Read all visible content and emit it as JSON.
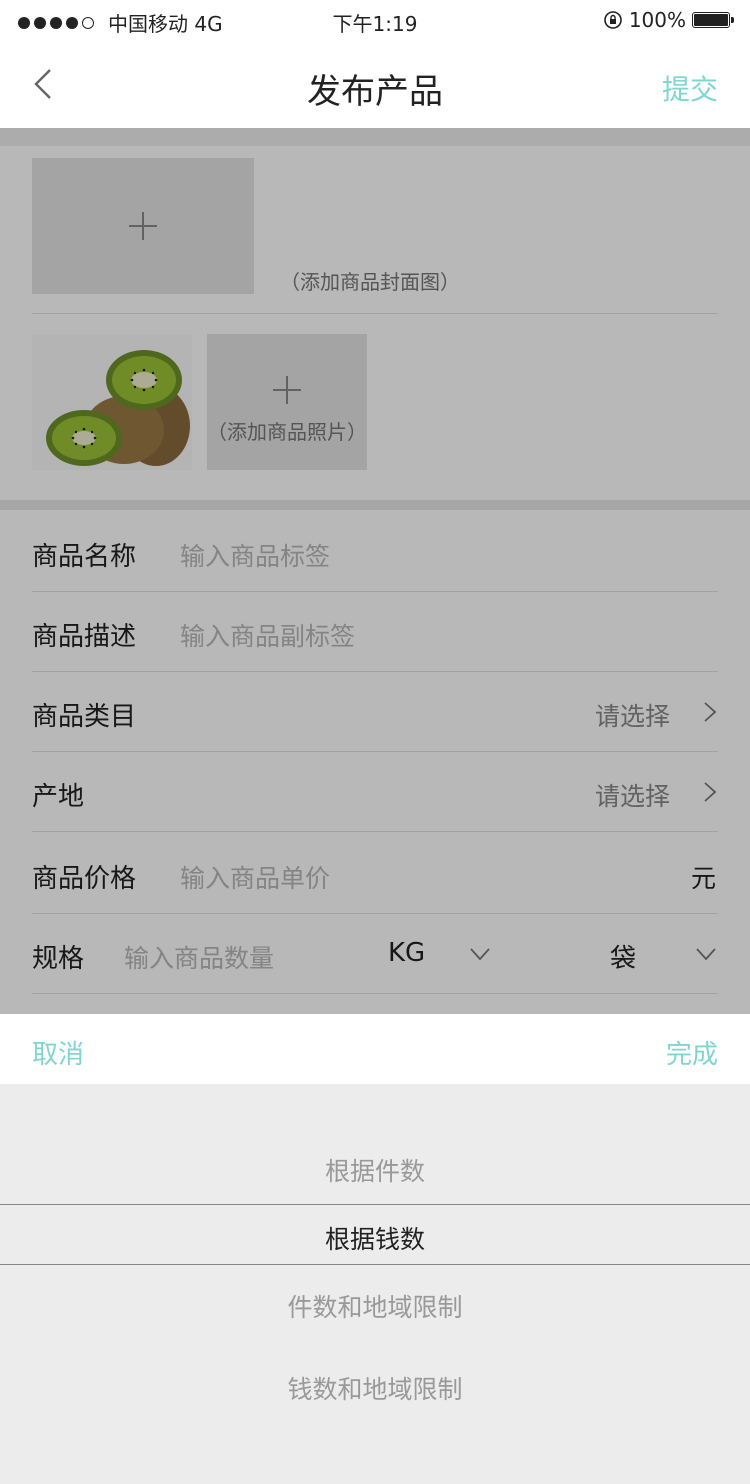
{
  "status_bar": {
    "carrier": "中国移动 4G",
    "time": "下午1:19",
    "battery": "100%"
  },
  "nav": {
    "title": "发布产品",
    "submit": "提交"
  },
  "images": {
    "cover_label": "（添加商品封面图）",
    "photo_add_label": "（添加商品照片）"
  },
  "form": {
    "name": {
      "label": "商品名称",
      "placeholder": "输入商品标签"
    },
    "desc": {
      "label": "商品描述",
      "placeholder": "输入商品副标签"
    },
    "category": {
      "label": "商品类目",
      "value": "请选择"
    },
    "origin": {
      "label": "产地",
      "value": "请选择"
    },
    "price": {
      "label": "商品价格",
      "placeholder": "输入商品单价",
      "unit": "元"
    },
    "spec": {
      "label": "规格",
      "placeholder": "输入商品数量",
      "unit1": "KG",
      "unit2": "袋"
    }
  },
  "picker": {
    "cancel": "取消",
    "done": "完成",
    "options": [
      "根据件数",
      "根据钱数",
      "件数和地域限制",
      "钱数和地域限制"
    ],
    "selected_index": 1
  },
  "colors": {
    "accent": "#7fd6d0"
  }
}
